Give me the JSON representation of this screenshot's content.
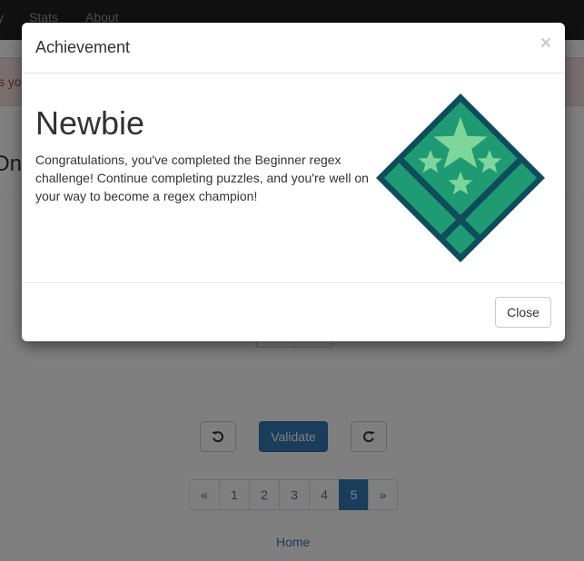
{
  "navbar": {
    "partial_item": "y",
    "stats": "Stats",
    "about": "About"
  },
  "alert": {
    "partial_text": "s yo"
  },
  "page": {
    "partial_heading": "One"
  },
  "controls": {
    "validate_label": "Validate",
    "undo_icon": "undo-icon",
    "redo_icon": "redo-icon"
  },
  "pagination": {
    "prev": "«",
    "pages": [
      "1",
      "2",
      "3",
      "4",
      "5"
    ],
    "active_page": "5",
    "next": "»"
  },
  "footer": {
    "home_link": "Home"
  },
  "modal": {
    "title": "Achievement",
    "close_symbol": "×",
    "badge_name": "Newbie",
    "message": "Congratulations, you've completed the Beginner regex challenge! Continue completing puzzles, and you're well on your way to become a regex champion!",
    "badge_icon": "star-diamond-badge-icon",
    "close_button": "Close"
  },
  "colors": {
    "badge_dark": "#0f4c5c",
    "badge_green": "#1f9b73",
    "badge_star": "#7ed69a",
    "primary": "#337ab7"
  }
}
